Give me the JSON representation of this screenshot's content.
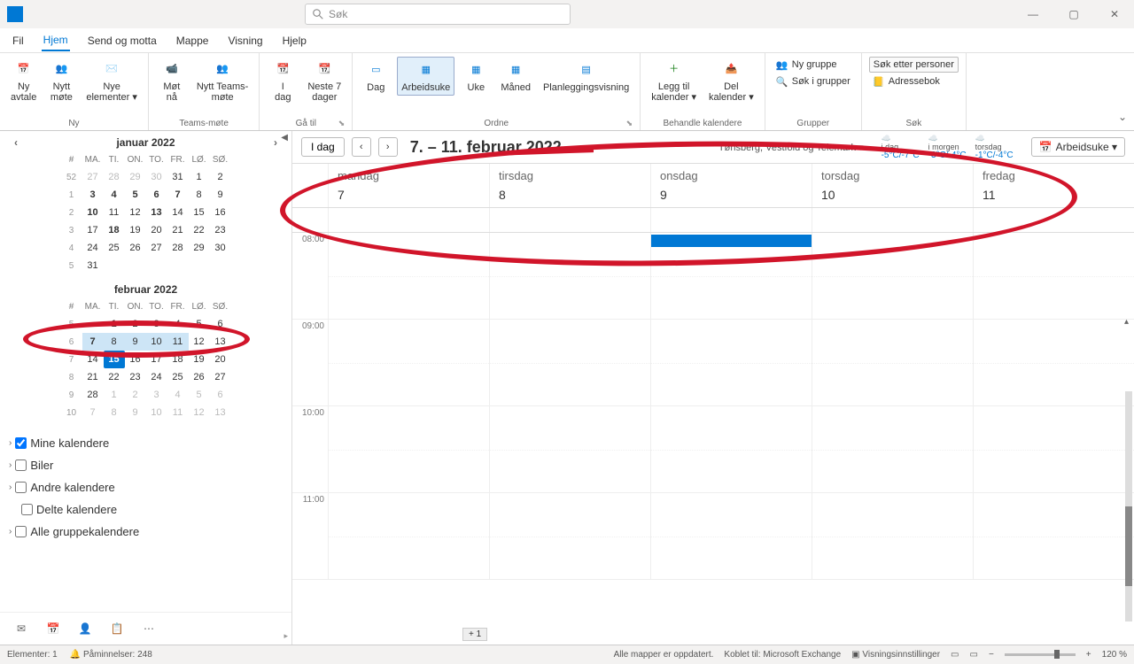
{
  "app": {
    "search_placeholder": "Søk"
  },
  "win": {
    "min": "—",
    "max": "▢",
    "close": "✕"
  },
  "menu": [
    "Fil",
    "Hjem",
    "Send og motta",
    "Mappe",
    "Visning",
    "Hjelp"
  ],
  "ribbon": {
    "ny": {
      "label": "Ny",
      "items": [
        {
          "label": "Ny\navtale"
        },
        {
          "label": "Nytt\nmøte"
        },
        {
          "label": "Nye\nelementer ▾"
        }
      ]
    },
    "teams": {
      "label": "Teams-møte",
      "items": [
        {
          "label": "Møt\nnå"
        },
        {
          "label": "Nytt Teams-\nmøte"
        }
      ]
    },
    "goto": {
      "label": "Gå til",
      "items": [
        {
          "label": "I\ndag"
        },
        {
          "label": "Neste 7\ndager"
        }
      ]
    },
    "ordne": {
      "label": "Ordne",
      "items": [
        {
          "label": "Dag"
        },
        {
          "label": "Arbeidsuke",
          "active": true
        },
        {
          "label": "Uke"
        },
        {
          "label": "Måned"
        },
        {
          "label": "Planleggingsvisning"
        }
      ]
    },
    "behandle": {
      "label": "Behandle kalendere",
      "items": [
        {
          "label": "Legg til\nkalender ▾"
        },
        {
          "label": "Del\nkalender ▾"
        }
      ]
    },
    "grupper": {
      "label": "Grupper",
      "items": [
        {
          "label": "Ny gruppe"
        },
        {
          "label": "Søk i grupper"
        }
      ]
    },
    "sok": {
      "label": "Søk",
      "items": [
        {
          "label": "Søk etter personer"
        },
        {
          "label": "Adressebok"
        }
      ]
    }
  },
  "sidebar": {
    "months": [
      {
        "title": "januar 2022",
        "show_nav": true,
        "headers": [
          "#",
          "MA.",
          "TI.",
          "ON.",
          "TO.",
          "FR.",
          "LØ.",
          "SØ."
        ],
        "rows": [
          {
            "wk": "52",
            "d": [
              "27",
              "28",
              "29",
              "30",
              "31",
              "1",
              "2"
            ],
            "out": [
              0,
              1,
              2,
              3
            ]
          },
          {
            "wk": "1",
            "d": [
              "3",
              "4",
              "5",
              "6",
              "7",
              "8",
              "9"
            ],
            "bold": [
              0,
              1,
              2,
              3,
              4
            ]
          },
          {
            "wk": "2",
            "d": [
              "10",
              "11",
              "12",
              "13",
              "14",
              "15",
              "16"
            ],
            "bold": [
              0,
              3
            ]
          },
          {
            "wk": "3",
            "d": [
              "17",
              "18",
              "19",
              "20",
              "21",
              "22",
              "23"
            ],
            "bold": [
              1
            ]
          },
          {
            "wk": "4",
            "d": [
              "24",
              "25",
              "26",
              "27",
              "28",
              "29",
              "30"
            ]
          },
          {
            "wk": "5",
            "d": [
              "31",
              "",
              "",
              "",
              "",
              "",
              ""
            ]
          }
        ]
      },
      {
        "title": "februar 2022",
        "show_nav": false,
        "headers": [
          "#",
          "MA.",
          "TI.",
          "ON.",
          "TO.",
          "FR.",
          "LØ.",
          "SØ."
        ],
        "rows": [
          {
            "wk": "5",
            "d": [
              "",
              "1",
              "2",
              "3",
              "4",
              "5",
              "6"
            ],
            "bold": [
              1
            ]
          },
          {
            "wk": "6",
            "d": [
              "7",
              "8",
              "9",
              "10",
              "11",
              "12",
              "13"
            ],
            "hl": [
              0,
              1,
              2,
              3,
              4
            ],
            "bold": [
              0
            ]
          },
          {
            "wk": "7",
            "d": [
              "14",
              "15",
              "16",
              "17",
              "18",
              "19",
              "20"
            ],
            "today": 1
          },
          {
            "wk": "8",
            "d": [
              "21",
              "22",
              "23",
              "24",
              "25",
              "26",
              "27"
            ]
          },
          {
            "wk": "9",
            "d": [
              "28",
              "1",
              "2",
              "3",
              "4",
              "5",
              "6"
            ],
            "out": [
              1,
              2,
              3,
              4,
              5,
              6
            ]
          },
          {
            "wk": "10",
            "d": [
              "7",
              "8",
              "9",
              "10",
              "11",
              "12",
              "13"
            ],
            "out": [
              0,
              1,
              2,
              3,
              4,
              5,
              6
            ]
          }
        ]
      }
    ],
    "groups": [
      {
        "label": "Mine kalendere",
        "checked": true,
        "chev": true
      },
      {
        "label": "Biler",
        "checked": false,
        "chev": true
      },
      {
        "label": "Andre kalendere",
        "checked": false,
        "chev": true
      },
      {
        "label": "Delte kalendere",
        "checked": false,
        "chev": false
      },
      {
        "label": "Alle gruppekalendere",
        "checked": false,
        "chev": true
      }
    ]
  },
  "cal": {
    "today": "I dag",
    "title": "7. – 11. februar 2022",
    "location": "Tønsberg, Vestfold og Telemark ▾",
    "weather": [
      {
        "d": "i dag",
        "t": "-5°C/-7°C"
      },
      {
        "d": "i morgen",
        "t": "-3°C/-4°C"
      },
      {
        "d": "torsdag",
        "t": "-1°C/-4°C"
      }
    ],
    "view": "Arbeidsuke ▾",
    "days": [
      {
        "name": "mandag",
        "num": "7"
      },
      {
        "name": "tirsdag",
        "num": "8"
      },
      {
        "name": "onsdag",
        "num": "9"
      },
      {
        "name": "torsdag",
        "num": "10"
      },
      {
        "name": "fredag",
        "num": "11"
      }
    ],
    "hours": [
      "08:00",
      "09:00",
      "10:00",
      "11:00"
    ],
    "plus1": "+ 1"
  },
  "status": {
    "elements": "Elementer: 1",
    "reminders": "Påminnelser: 248",
    "sync": "Alle mapper er oppdatert.",
    "conn": "Koblet til: Microsoft Exchange",
    "viewsettings": "Visningsinnstillinger",
    "zoom": "120 %"
  }
}
